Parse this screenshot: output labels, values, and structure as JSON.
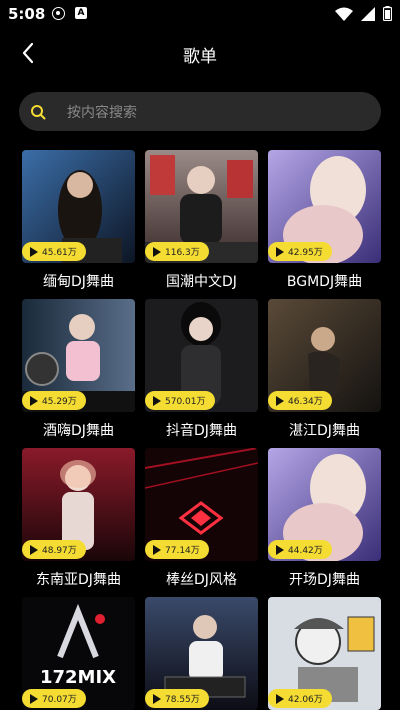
{
  "status": {
    "time": "5:08",
    "b_icon": "A"
  },
  "header": {
    "title": "歌单"
  },
  "search": {
    "placeholder": "按内容搜索"
  },
  "cards": [
    {
      "title": "缅甸DJ舞曲",
      "plays": "45.61万"
    },
    {
      "title": "国潮中文DJ",
      "plays": "116.3万"
    },
    {
      "title": "BGMDJ舞曲",
      "plays": "42.95万"
    },
    {
      "title": "酒嗨DJ舞曲",
      "plays": "45.29万"
    },
    {
      "title": "抖音DJ舞曲",
      "plays": "570.01万"
    },
    {
      "title": "湛江DJ舞曲",
      "plays": "46.34万"
    },
    {
      "title": "东南亚DJ舞曲",
      "plays": "48.97万"
    },
    {
      "title": "棒丝DJ风格",
      "plays": "77.14万"
    },
    {
      "title": "开场DJ舞曲",
      "plays": "44.42万"
    },
    {
      "title": "",
      "plays": "70.07万",
      "logo_text": "172MIX"
    },
    {
      "title": "",
      "plays": "78.55万"
    },
    {
      "title": "",
      "plays": "42.06万"
    }
  ],
  "colors": {
    "accent": "#f4dc32",
    "background": "#000000",
    "search_bg": "#2a2a2a"
  }
}
